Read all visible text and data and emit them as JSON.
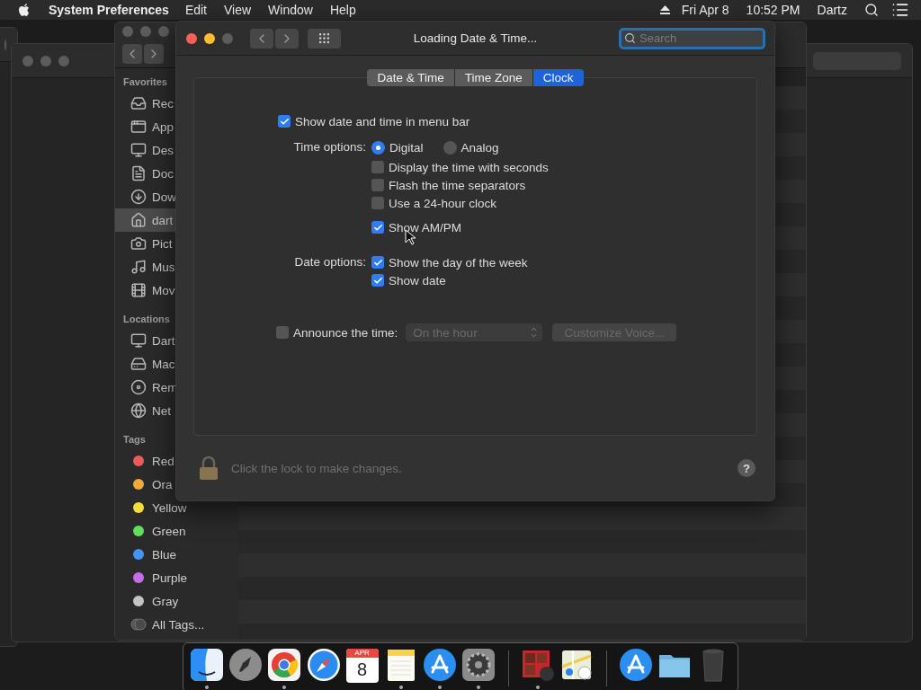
{
  "menubar": {
    "app": "System Preferences",
    "menus": [
      "Edit",
      "View",
      "Window",
      "Help"
    ],
    "date": "Fri Apr 8",
    "time": "10:52 PM",
    "user": "Dartz"
  },
  "finder": {
    "sections": [
      {
        "title": "Favorites",
        "items": [
          {
            "label": "Rec",
            "kind": "recents",
            "selected": false
          },
          {
            "label": "App",
            "kind": "apps",
            "selected": false
          },
          {
            "label": "Des",
            "kind": "desktop",
            "selected": false
          },
          {
            "label": "Doc",
            "kind": "documents",
            "selected": false
          },
          {
            "label": "Dow",
            "kind": "downloads",
            "selected": false
          },
          {
            "label": "dart",
            "kind": "home",
            "selected": true
          },
          {
            "label": "Pict",
            "kind": "pictures",
            "selected": false
          },
          {
            "label": "Mus",
            "kind": "music",
            "selected": false
          },
          {
            "label": "Mov",
            "kind": "movies",
            "selected": false
          }
        ]
      },
      {
        "title": "Locations",
        "items": [
          {
            "label": "Dart",
            "kind": "computer",
            "selected": false
          },
          {
            "label": "Mac",
            "kind": "disk",
            "selected": false
          },
          {
            "label": "Rem",
            "kind": "disc",
            "selected": false
          },
          {
            "label": "Net",
            "kind": "network",
            "selected": false
          }
        ]
      },
      {
        "title": "Tags",
        "items": [
          {
            "label": "Red",
            "kind": "tag",
            "color": "#ee5a5a",
            "selected": false
          },
          {
            "label": "Ora",
            "kind": "tag",
            "color": "#f4a73a",
            "selected": false
          },
          {
            "label": "Yellow",
            "kind": "tag",
            "color": "#f3dc3b",
            "selected": false
          },
          {
            "label": "Green",
            "kind": "tag",
            "color": "#5fe05a",
            "selected": false
          },
          {
            "label": "Blue",
            "kind": "tag",
            "color": "#3e95f6",
            "selected": false
          },
          {
            "label": "Purple",
            "kind": "tag",
            "color": "#c86bec",
            "selected": false
          },
          {
            "label": "Gray",
            "kind": "tag",
            "color": "#c4c4c4",
            "selected": false
          },
          {
            "label": "All Tags...",
            "kind": "all-tags",
            "selected": false
          }
        ]
      }
    ]
  },
  "prefs": {
    "title": "Loading Date & Time...",
    "search": {
      "placeholder": "Search"
    },
    "tabs": [
      {
        "label": "Date & Time",
        "selected": false
      },
      {
        "label": "Time Zone",
        "selected": false
      },
      {
        "label": "Clock",
        "selected": true
      }
    ],
    "menubar_option": {
      "label": "Show date and time in menu bar",
      "checked": true
    },
    "time_options": {
      "label": "Time options:",
      "modes": [
        {
          "label": "Digital",
          "selected": true
        },
        {
          "label": "Analog",
          "selected": false
        }
      ],
      "options": [
        {
          "label": "Display the time with seconds",
          "checked": false
        },
        {
          "label": "Flash the time separators",
          "checked": false
        },
        {
          "label": "Use a 24-hour clock",
          "checked": false
        }
      ],
      "am_pm": {
        "label": "Show AM/PM",
        "checked": true
      }
    },
    "date_options": {
      "label": "Date options:",
      "options": [
        {
          "label": "Show the day of the week",
          "checked": true
        },
        {
          "label": "Show date",
          "checked": true
        }
      ]
    },
    "announce": {
      "label": "Announce the time:",
      "checked": false,
      "interval": {
        "value": "On the hour",
        "disabled": true
      },
      "voice_button": {
        "label": "Customize Voice...",
        "disabled": true
      }
    },
    "lock_text": "Click the lock to make changes.",
    "help": "?"
  },
  "dock": [
    {
      "kind": "finder",
      "running": true
    },
    {
      "kind": "launchpad",
      "running": false
    },
    {
      "kind": "chrome",
      "running": true
    },
    {
      "kind": "safari",
      "running": false
    },
    {
      "kind": "calendar",
      "month": "APR",
      "day": "8",
      "running": false
    },
    {
      "kind": "notes",
      "running": true
    },
    {
      "kind": "appstore",
      "running": true
    },
    {
      "kind": "settings",
      "running": true
    },
    {
      "kind": "separator"
    },
    {
      "kind": "photobooth",
      "running": true
    },
    {
      "kind": "maps",
      "running": false
    },
    {
      "kind": "separator"
    },
    {
      "kind": "appstore",
      "running": false
    },
    {
      "kind": "folder",
      "running": false
    },
    {
      "kind": "trash",
      "running": false
    }
  ]
}
